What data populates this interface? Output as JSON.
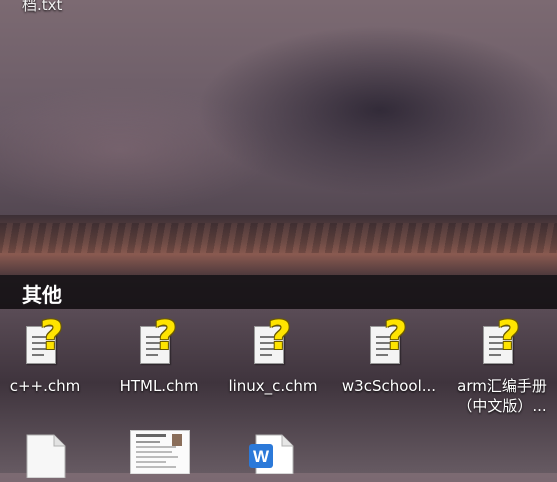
{
  "desktop": {
    "top_file_label": "档.txt",
    "section_title": "其他",
    "items": [
      {
        "label": "c++.chm",
        "icon": "chm-help-icon"
      },
      {
        "label": "HTML.chm",
        "icon": "chm-help-icon"
      },
      {
        "label": "linux_c.chm",
        "icon": "chm-help-icon"
      },
      {
        "label": "w3cSchool...",
        "icon": "chm-help-icon"
      },
      {
        "label": "arm汇编手册",
        "label2": "（中文版）...",
        "icon": "chm-help-icon"
      }
    ],
    "partial_items": [
      {
        "icon": "blank-document-icon"
      },
      {
        "icon": "resume-image-icon"
      },
      {
        "icon": "word-document-icon",
        "badge": "W"
      }
    ]
  }
}
